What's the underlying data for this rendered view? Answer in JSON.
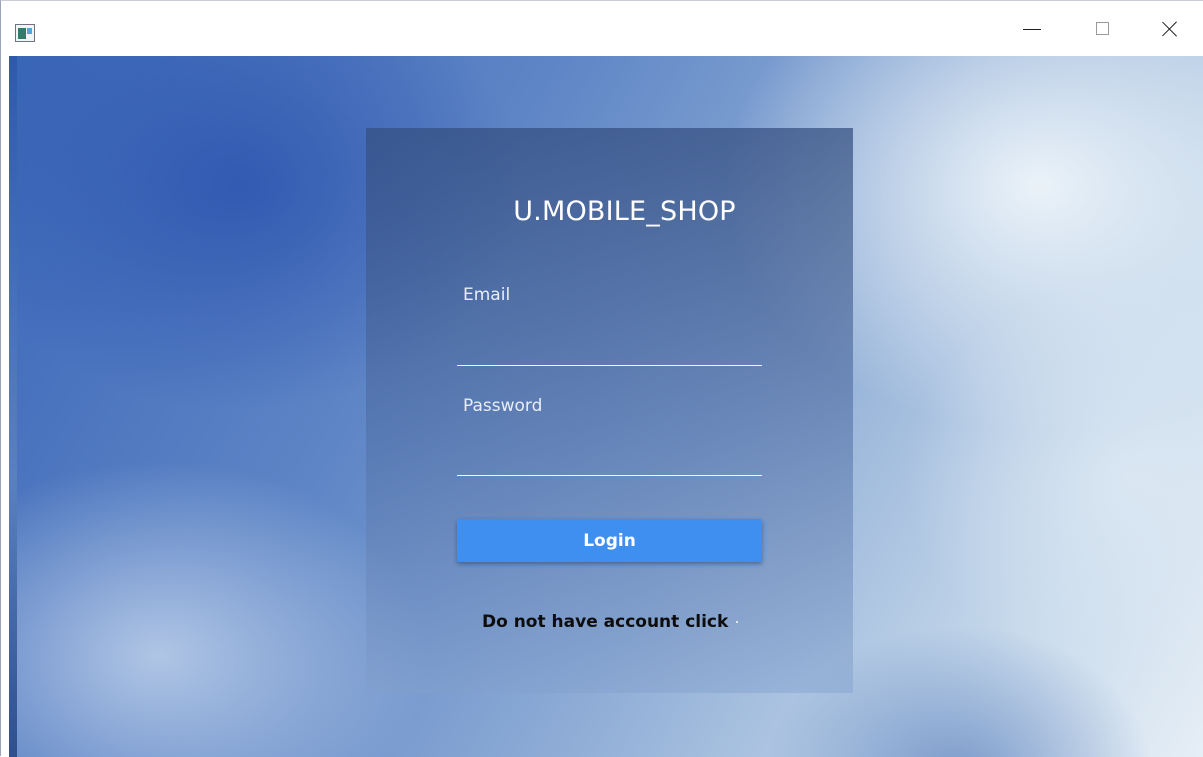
{
  "window": {
    "controls": [
      "minimize",
      "maximize",
      "close"
    ]
  },
  "login": {
    "brand": "U.MOBILE_SHOP",
    "email_label": "Email",
    "email_value": "",
    "password_label": "Password",
    "password_value": "",
    "login_button": "Login",
    "signup_text": "Do not have account click"
  },
  "colors": {
    "button": "#3f8ff0",
    "card_overlay": "#344e80",
    "text_light": "#ffffff"
  }
}
